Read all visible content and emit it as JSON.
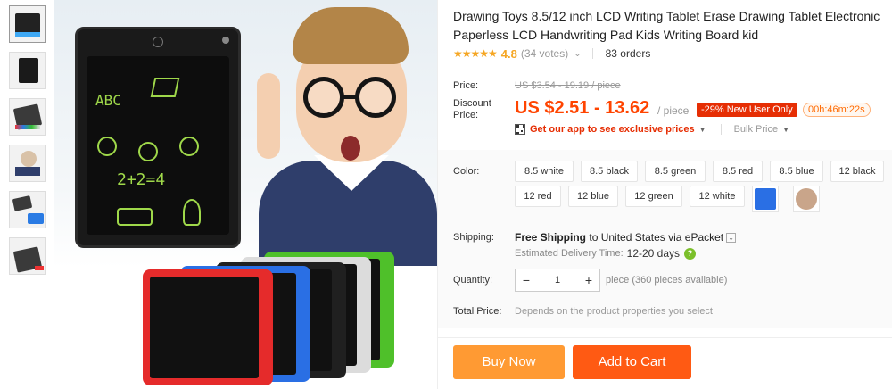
{
  "product": {
    "title": "Drawing Toys 8.5/12 inch LCD Writing Tablet Erase Drawing Tablet Electronic Paperless LCD Handwriting Pad Kids Writing Board kid",
    "rating": {
      "stars": "★★★★★",
      "score": "4.8",
      "votes": "(34 votes)",
      "orders": "83 orders"
    }
  },
  "price": {
    "price_label": "Price:",
    "original": "US $3.54 - 19.19 / piece",
    "discount_label": "Discount Price:",
    "discounted": "US $2.51 - 13.62",
    "unit": "/ piece",
    "badge": "-29% New User Only",
    "timer": "00h:46m:22s",
    "app_promo": "Get our app to see exclusive prices",
    "bulk": "Bulk Price"
  },
  "color": {
    "label": "Color:",
    "options": [
      "8.5 white",
      "8.5 black",
      "8.5 green",
      "8.5 red",
      "8.5 blue",
      "12 black",
      "12 red",
      "12 blue",
      "12 green",
      "12 white"
    ]
  },
  "shipping": {
    "label": "Shipping:",
    "free": "Free Shipping",
    "to": "to",
    "country": "United States",
    "via": "via ePacket",
    "estimated_label": "Estimated Delivery Time:",
    "days": "12-20 days",
    "help": "?"
  },
  "quantity": {
    "label": "Quantity:",
    "value": "1",
    "minus": "−",
    "plus": "+",
    "note": "piece (360 pieces available)"
  },
  "total": {
    "label": "Total Price:",
    "note": "Depends on the product properties you select"
  },
  "actions": {
    "buy_now": "Buy Now",
    "add_to_cart": "Add to Cart"
  },
  "image_text": {
    "abc": "ABC",
    "sum": "2+2=4"
  },
  "colors": {
    "accent": "#ff4400",
    "buy_now": "#ff9a33",
    "add_to_cart": "#ff5a13",
    "star": "#f5a623",
    "badge": "#e62e04"
  }
}
